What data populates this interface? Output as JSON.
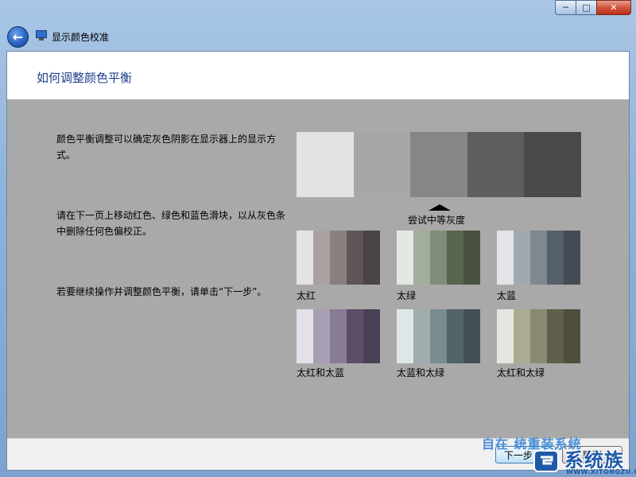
{
  "window": {
    "title": "显示颜色校准",
    "controls": {
      "minimize": "─",
      "maximize": "□",
      "close": "✕"
    }
  },
  "nav": {
    "back_icon": "back-arrow-icon",
    "back_glyph": "←"
  },
  "page": {
    "heading": "如何调整颜色平衡",
    "paragraphs": [
      "颜色平衡调整可以确定灰色阴影在显示器上的显示方式。",
      "请在下一页上移动红色、绿色和蓝色滑块，以从灰色条中删除任何色偏校正。",
      "若要继续操作并调整颜色平衡，请单击“下一步”。"
    ]
  },
  "gray_strip": {
    "colors": [
      "#e3e3e3",
      "#a7a7a7",
      "#868686",
      "#5e5e5e",
      "#494949"
    ],
    "marker_label": "尝试中等灰度"
  },
  "samples": [
    {
      "label": "太红",
      "colors": [
        "#e5e2e2",
        "#aaa2a2",
        "#8a8080",
        "#5e5656",
        "#4b4444"
      ]
    },
    {
      "label": "太绿",
      "colors": [
        "#e4e8e2",
        "#a2ae9c",
        "#7f8e78",
        "#58654f",
        "#48523f"
      ]
    },
    {
      "label": "太蓝",
      "colors": [
        "#e2e4e8",
        "#a1a9b0",
        "#7e8891",
        "#566069",
        "#454c55"
      ]
    },
    {
      "label": "太红和太蓝",
      "colors": [
        "#e6e0e8",
        "#a99fb2",
        "#887b94",
        "#5b4f67",
        "#4a4056"
      ]
    },
    {
      "label": "太蓝和太绿",
      "colors": [
        "#e0e6e6",
        "#9eaeae",
        "#7a8d8e",
        "#526465",
        "#425254"
      ]
    },
    {
      "label": "太红和太绿",
      "colors": [
        "#e6e6e0",
        "#abab93",
        "#8a8a72",
        "#5f5f4c",
        "#4e4e3c"
      ]
    }
  ],
  "footer": {
    "next_label": "下一步(N)",
    "cancel_label": "取消"
  },
  "watermark": {
    "line1": "自在 统重装系统",
    "brand": "系统族",
    "url": "WWW.XITONGZU.COM"
  }
}
